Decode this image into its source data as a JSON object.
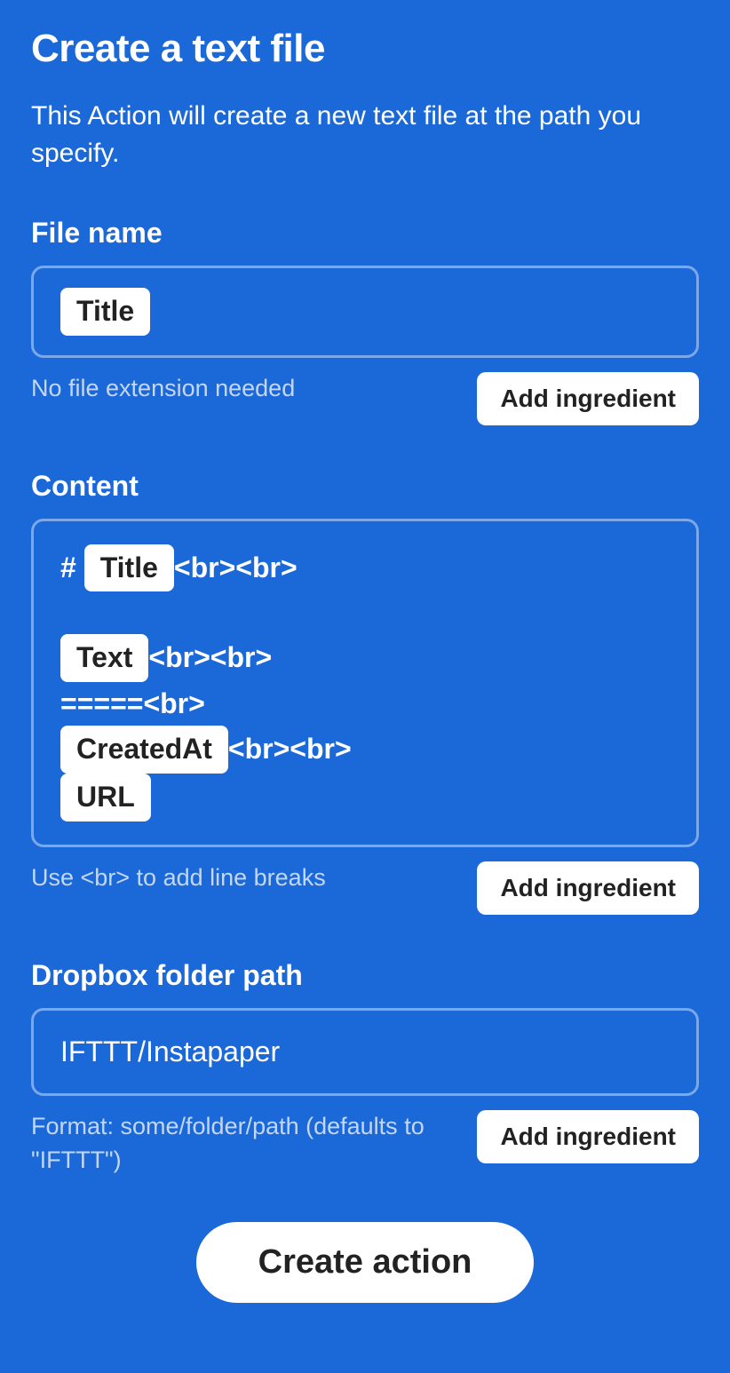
{
  "header": {
    "title": "Create a text file",
    "description": "This Action will create a new text file at the path you specify."
  },
  "fields": {
    "filename": {
      "label": "File name",
      "chips": [
        "Title"
      ],
      "hint": "No file extension needed",
      "add_button": "Add ingredient"
    },
    "content": {
      "label": "Content",
      "lines": {
        "l1_prefix": "# ",
        "l1_chip": "Title",
        "l1_suffix": "<br><br>",
        "l2_chip": "Text",
        "l2_suffix": "<br><br>",
        "l3_text": "=====<br>",
        "l4_chip": "CreatedAt",
        "l4_suffix": "<br><br>",
        "l5_chip": "URL"
      },
      "hint": "Use <br> to add line breaks",
      "add_button": "Add ingredient"
    },
    "folder": {
      "label": "Dropbox folder path",
      "value": "IFTTT/Instapaper",
      "hint": "Format: some/folder/path (defaults to \"IFTTT\")",
      "add_button": "Add ingredient"
    }
  },
  "footer": {
    "create_button": "Create action"
  }
}
